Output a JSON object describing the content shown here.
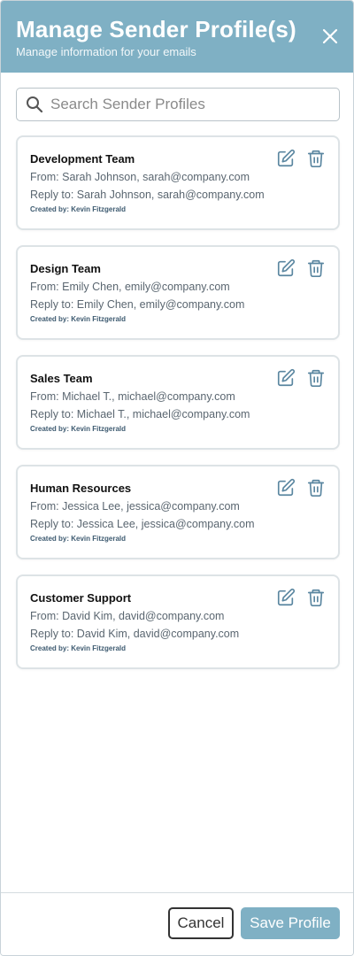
{
  "header": {
    "title": "Manage Sender Profile(s)",
    "subtitle": "Manage information for your emails"
  },
  "search": {
    "placeholder": "Search Sender Profiles",
    "value": ""
  },
  "profiles": [
    {
      "name": "Development Team",
      "from": "From: Sarah Johnson, sarah@company.com",
      "reply_to": "Reply to: Sarah Johnson, sarah@company.com",
      "created_by": "Created by: Kevin Fitzgerald"
    },
    {
      "name": "Design Team",
      "from": "From: Emily Chen, emily@company.com",
      "reply_to": "Reply to: Emily Chen, emily@company.com",
      "created_by": "Created by: Kevin Fitzgerald"
    },
    {
      "name": "Sales Team",
      "from": "From: Michael T., michael@company.com",
      "reply_to": "Reply to: Michael T., michael@company.com",
      "created_by": "Created by: Kevin Fitzgerald"
    },
    {
      "name": "Human Resources",
      "from": "From: Jessica Lee, jessica@company.com",
      "reply_to": "Reply to: Jessica Lee, jessica@company.com",
      "created_by": "Created by: Kevin Fitzgerald"
    },
    {
      "name": "Customer Support",
      "from": "From: David Kim, david@company.com",
      "reply_to": "Reply to: David Kim, david@company.com",
      "created_by": "Created by: Kevin Fitzgerald"
    }
  ],
  "footer": {
    "cancel_label": "Cancel",
    "save_label": "Save Profile"
  },
  "icons": {
    "close": "close-icon",
    "search": "search-icon",
    "edit": "edit-icon",
    "delete": "trash-icon"
  },
  "colors": {
    "accent": "#7fb0c4",
    "icon": "#5a86a0"
  }
}
